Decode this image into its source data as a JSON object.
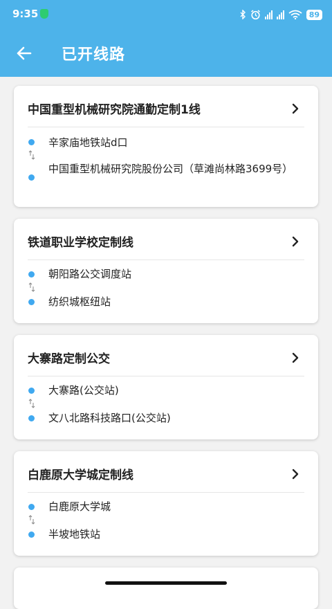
{
  "status_bar": {
    "time": "9:35",
    "battery": "89"
  },
  "header": {
    "title": "已开线路"
  },
  "routes": [
    {
      "name": "中国重型机械研究院通勤定制1线",
      "from": "辛家庙地铁站d口",
      "to": "中国重型机械研究院股份公司（草滩尚林路3699号）"
    },
    {
      "name": "铁道职业学校定制线",
      "from": "朝阳路公交调度站",
      "to": "纺织城枢纽站"
    },
    {
      "name": "大寨路定制公交",
      "from": "大寨路(公交站)",
      "to": "文八北路科技路口(公交站)"
    },
    {
      "name": "白鹿原大学城定制线",
      "from": "白鹿原大学城",
      "to": "半坡地铁站"
    }
  ],
  "colors": {
    "header_bg": "#4db3ea",
    "stop_dot": "#40a9f0",
    "page_bg": "#f2f2f2"
  },
  "icons": [
    "back-arrow-icon",
    "chevron-right-icon",
    "swap-arrows-icon",
    "bluetooth-icon",
    "alarm-icon",
    "wifi-icon",
    "signal-icon",
    "battery-icon"
  ]
}
